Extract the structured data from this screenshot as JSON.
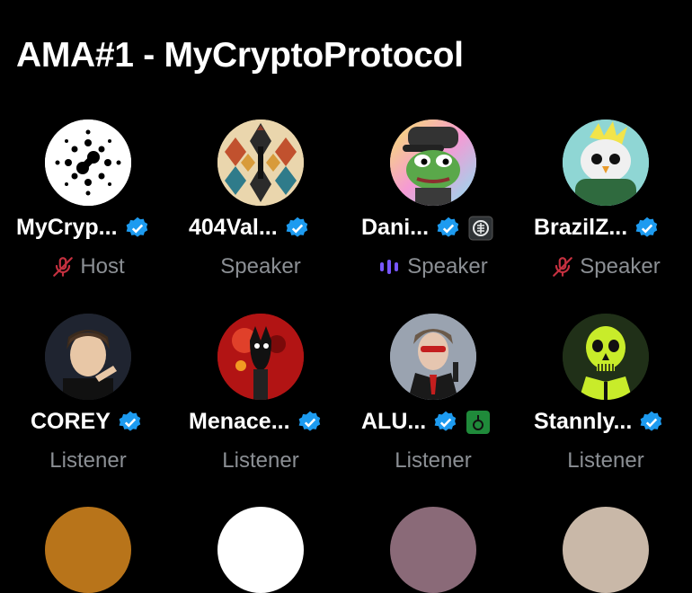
{
  "space": {
    "title": "AMA#1 - MyCryptoProtocol"
  },
  "participants": [
    {
      "name": "MyCryp...",
      "role": "Host",
      "verified": true,
      "role_icon": "muted-mic-icon",
      "extra_badge": ""
    },
    {
      "name": "404Val...",
      "role": "Speaker",
      "verified": true,
      "role_icon": "",
      "extra_badge": ""
    },
    {
      "name": "Dani...",
      "role": "Speaker",
      "verified": true,
      "role_icon": "speaking-bars-icon",
      "extra_badge": "affiliate-badge-icon"
    },
    {
      "name": "BrazilZ...",
      "role": "Speaker",
      "verified": true,
      "role_icon": "muted-mic-icon",
      "extra_badge": ""
    },
    {
      "name": "COREY",
      "role": "Listener",
      "verified": true,
      "role_icon": "",
      "extra_badge": ""
    },
    {
      "name": "Menace...",
      "role": "Listener",
      "verified": true,
      "role_icon": "",
      "extra_badge": ""
    },
    {
      "name": "ALU...",
      "role": "Listener",
      "verified": true,
      "role_icon": "",
      "extra_badge": "green-affiliate-badge-icon"
    },
    {
      "name": "Stannly...",
      "role": "Listener",
      "verified": true,
      "role_icon": "",
      "extra_badge": ""
    }
  ],
  "colors": {
    "background": "#000000",
    "name": "#ffffff",
    "role": "#8b8f94",
    "verified": "#1d9bf0",
    "muted_mic": "#c4303f",
    "speaking": "#7856ff"
  }
}
